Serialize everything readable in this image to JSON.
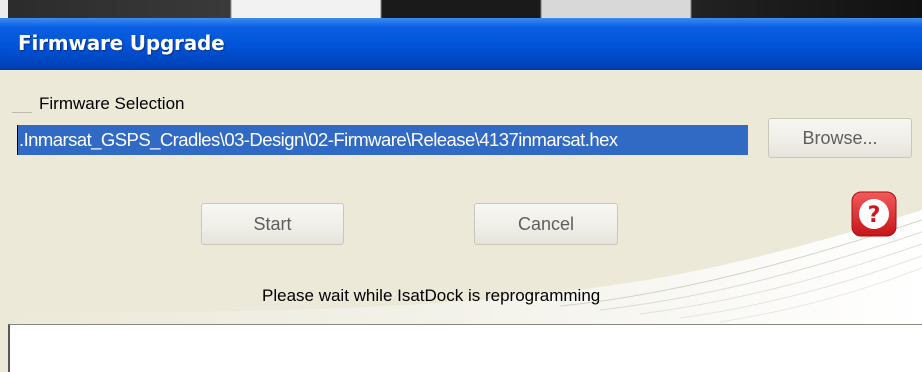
{
  "window": {
    "title": "Firmware Upgrade"
  },
  "firmware_selection": {
    "group_label": "Firmware Selection",
    "path_value": ".Inmarsat_GSPS_Cradles\\03-Design\\02-Firmware\\Release\\4137inmarsat.hex",
    "browse_label": "Browse..."
  },
  "actions": {
    "start_label": "Start",
    "cancel_label": "Cancel"
  },
  "help": {
    "icon": "question-mark-icon",
    "glyph": "?"
  },
  "status": {
    "message": "Please wait while IsatDock is reprogramming"
  },
  "progress": {
    "value": 0
  },
  "colors": {
    "titlebar": "#0052d6",
    "selection": "#316ac5",
    "client_bg": "#ece9d8",
    "help_red": "#e8262b"
  }
}
